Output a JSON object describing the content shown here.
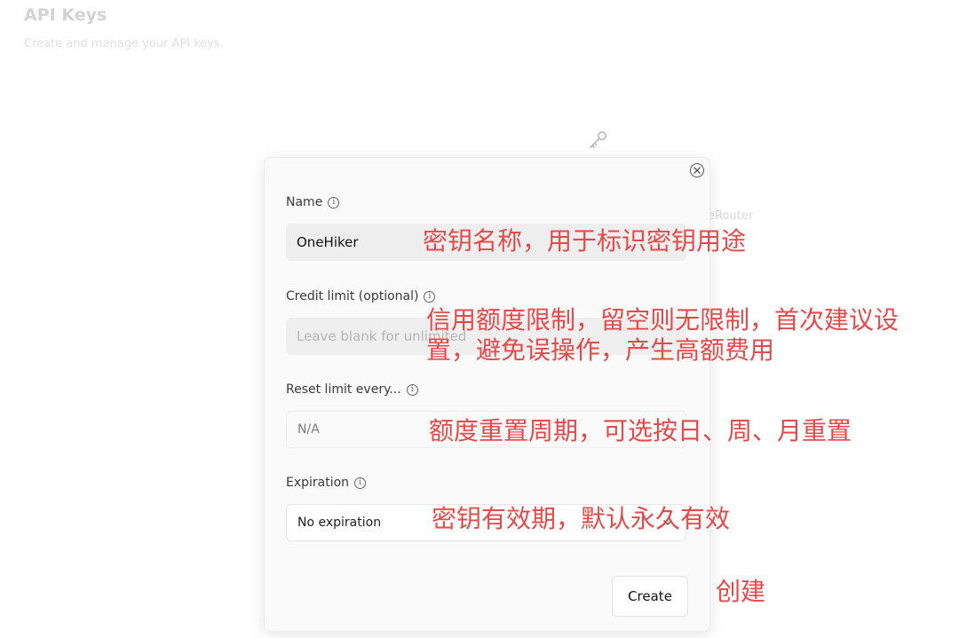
{
  "page": {
    "title": "API Keys",
    "subtitle": "Create and manage your API keys."
  },
  "background": {
    "partial_text": "eRouter"
  },
  "modal": {
    "fields": {
      "name": {
        "label": "Name",
        "value": "OneHiker"
      },
      "credit_limit": {
        "label": "Credit limit (optional)",
        "placeholder": "Leave blank for unlimited"
      },
      "reset_limit": {
        "label": "Reset limit every...",
        "value": "N/A"
      },
      "expiration": {
        "label": "Expiration",
        "selected": "No expiration"
      }
    },
    "create_label": "Create"
  },
  "annotations": {
    "name": "密钥名称，用于标识密钥用途",
    "credit_limit": "信用额度限制，留空则无限制，首次建议设置，避免误操作，产生高额费用",
    "reset_limit": "额度重置周期，可选按日、周、月重置",
    "expiration": "密钥有效期，默认永久有效",
    "create": "创建"
  },
  "icons": {
    "background": "key-icon",
    "close": "close-icon",
    "info": "info-icon",
    "dropdown": "chevron-down-icon"
  },
  "colors": {
    "annotation": "#e34a4a"
  }
}
